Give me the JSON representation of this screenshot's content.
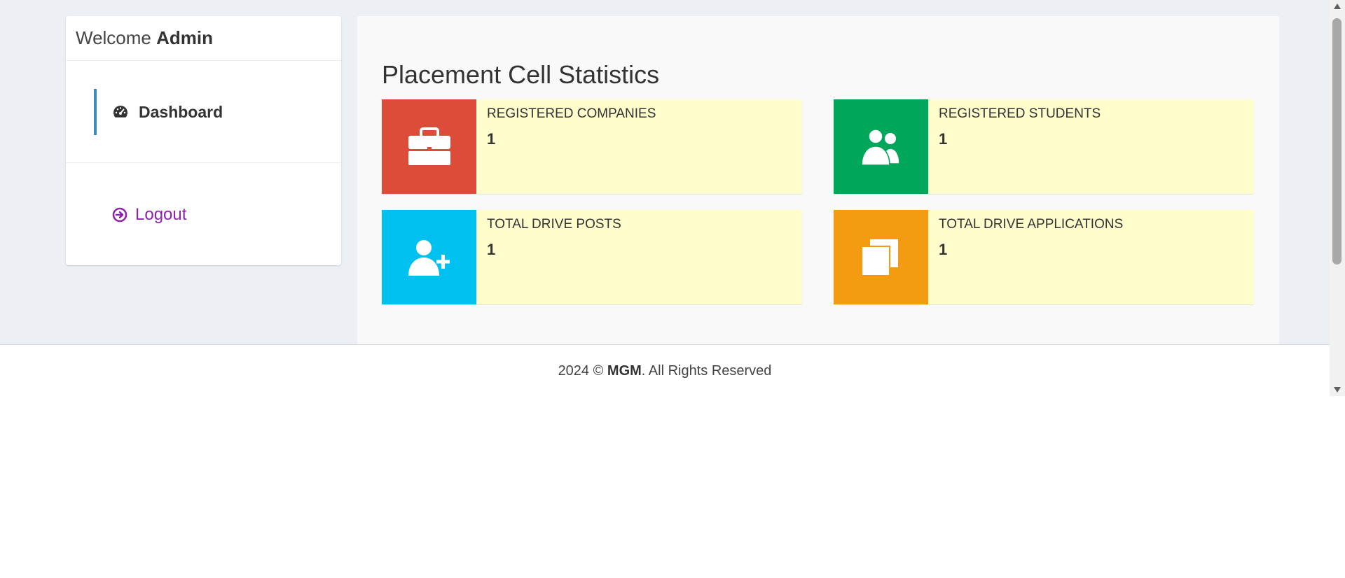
{
  "sidebar": {
    "welcome_prefix": "Welcome ",
    "welcome_user": "Admin",
    "items": [
      {
        "label": "Dashboard",
        "icon": "dashboard-icon",
        "active": true,
        "accent": "#3c8dbc"
      },
      {
        "label": "Logout",
        "icon": "logout-icon",
        "color": "#8e24aa"
      }
    ]
  },
  "main": {
    "title": "Placement Cell Statistics",
    "boxes": [
      {
        "label": "REGISTERED COMPANIES",
        "value": "1",
        "icon": "briefcase-icon",
        "color": "#dd4b39"
      },
      {
        "label": "REGISTERED STUDENTS",
        "value": "1",
        "icon": "users-icon",
        "color": "#00a65a"
      },
      {
        "label": "TOTAL DRIVE POSTS",
        "value": "1",
        "icon": "user-plus-icon",
        "color": "#00c0ef"
      },
      {
        "label": "TOTAL DRIVE APPLICATIONS",
        "value": "1",
        "icon": "copy-icon",
        "color": "#f39c12"
      }
    ],
    "box_background": "#fffdcc"
  },
  "footer": {
    "year_prefix": "2024 © ",
    "brand": "MGM",
    "suffix": ". All Rights Reserved"
  }
}
